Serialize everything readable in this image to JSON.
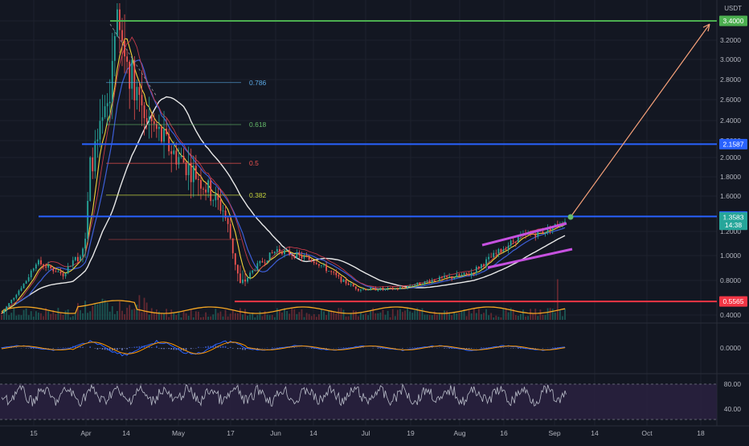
{
  "chart_data": {
    "type": "candlestick",
    "symbol_quote": "USDT",
    "price_axis": {
      "ticks": [
        "3.4000",
        "3.2000",
        "3.0000",
        "2.8000",
        "2.6000",
        "2.4000",
        "2.2000",
        "2.0000",
        "1.8000",
        "1.6000",
        "1.2000",
        "1.0000",
        "0.8000",
        "0.4000"
      ],
      "range": [
        0.35,
        3.6
      ],
      "top_tick_label": "3.4000"
    },
    "time_axis": {
      "labels": [
        "15",
        "Apr",
        "14",
        "May",
        "17",
        "Jun",
        "14",
        "Jul",
        "19",
        "Aug",
        "16",
        "Sep",
        "14",
        "Oct",
        "18"
      ]
    },
    "price_labels": [
      {
        "text": "3.4000",
        "value": 3.4,
        "color": "#4caf50"
      },
      {
        "text": "2.1587",
        "value": 2.1587,
        "color": "#2962ff"
      },
      {
        "text": "1.3694",
        "value": 1.3694,
        "color": "#2962ff"
      },
      {
        "text": "1.3583",
        "value": 1.3583,
        "color": "#26a69a"
      },
      {
        "text": "14:38",
        "value": 1.275,
        "color": "#26a69a"
      },
      {
        "text": "0.5565",
        "value": 0.5565,
        "color": "#f23645"
      }
    ],
    "horizontal_levels": [
      {
        "value": 3.4,
        "color": "#4caf50"
      },
      {
        "value": 2.1587,
        "color": "#2962ff"
      },
      {
        "value": 1.3694,
        "color": "#2962ff"
      },
      {
        "value": 0.5565,
        "color": "#f23645"
      }
    ],
    "fibonacci": [
      {
        "label": "0.786",
        "value": 2.77,
        "color": "#5ba8e5"
      },
      {
        "label": "0.618",
        "value": 2.36,
        "color": "#66bb6a"
      },
      {
        "label": "0.5",
        "value": 1.94,
        "color": "#ef5350"
      },
      {
        "label": "0.382",
        "value": 1.61,
        "color": "#c6d33a"
      }
    ],
    "oscillator_panel": {
      "zero_label": "0.0000"
    },
    "rsi_panel": {
      "ticks": [
        "80.00",
        "40.00"
      ]
    },
    "colors": {
      "background": "#131722",
      "bull": "#26a69a",
      "bear": "#ef5350",
      "projection_arrow": "#f7a17a",
      "channel": "#c651e0",
      "rsi_line": "#b8bcc8",
      "rsi_band": "#2a2140",
      "ma_white": "#e8e8e8",
      "ma_yellow": "#f5d33a",
      "ma_blue": "#3d5fd8",
      "ma_red": "#c53a4b",
      "volume_ma": "#f5a623"
    }
  }
}
